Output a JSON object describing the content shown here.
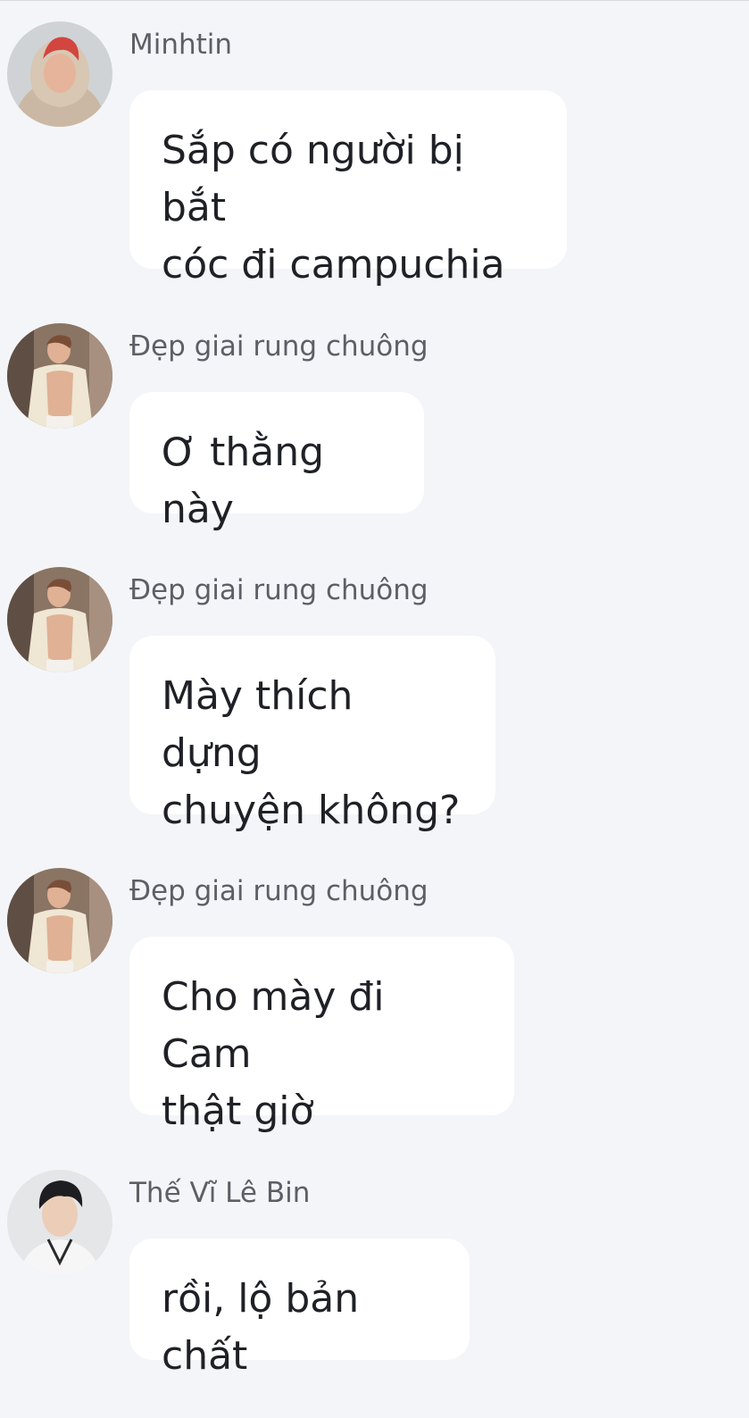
{
  "messages": [
    {
      "sender": "Minhtin",
      "text": "Sắp có người bị bắt\ncóc đi campuchia",
      "avatar": "avatar-red-hair"
    },
    {
      "sender": "Đẹp giai rung chuông",
      "text": "Ơ thằng này",
      "avatar": "avatar-shirtless"
    },
    {
      "sender": "Đẹp giai rung chuông",
      "text": "Mày thích dựng\nchuyện không?",
      "avatar": "avatar-shirtless"
    },
    {
      "sender": "Đẹp giai rung chuông",
      "text": "Cho mày đi Cam\nthật giờ",
      "avatar": "avatar-shirtless"
    },
    {
      "sender": "Thế Vĩ Lê Bin",
      "text": "rồi, lộ bản chất",
      "avatar": "avatar-dark-hair"
    }
  ],
  "colors": {
    "background": "#f4f5f8",
    "bubble": "#ffffff",
    "sender_text": "#5c5f66",
    "message_text": "#1f2126"
  }
}
